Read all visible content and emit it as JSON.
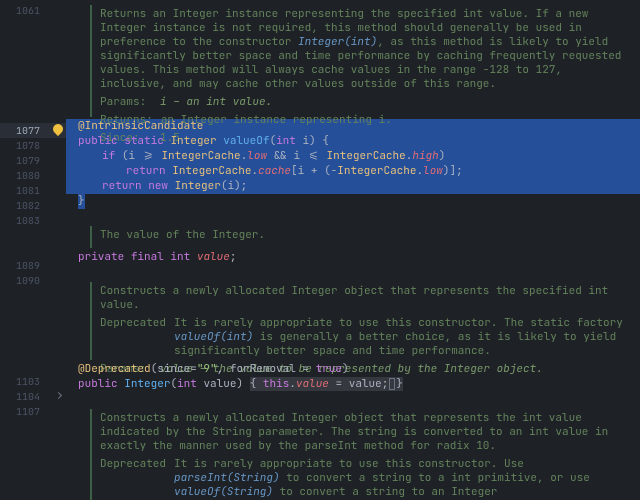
{
  "gutter": {
    "lines": [
      1061,
      "",
      "",
      "",
      "",
      "",
      "",
      "",
      1077,
      1078,
      1079,
      1080,
      1081,
      1082,
      1083,
      "",
      "",
      1089,
      1090,
      "",
      "",
      "",
      "",
      "",
      "",
      1103,
      1104,
      1107,
      "",
      "",
      "",
      "",
      ""
    ]
  },
  "docs": {
    "valueOf": {
      "body": "Returns an Integer instance representing the specified int value. If a new Integer instance is not required, this method should generally be used in preference to the constructor ",
      "ctor": "Integer(int)",
      "body2": ", as this method is likely to yield significantly better space and time performance by caching frequently requested values. This method will always cache values in the range -128 to 127, inclusive, and may cache other values outside of this range.",
      "params_lbl": "Params:",
      "params_val": "i – an int value.",
      "returns_lbl": "Returns:",
      "returns_val": "an Integer instance representing i.",
      "since_lbl": "Since:",
      "since_val": "1.5"
    },
    "value": {
      "body": "The value of the Integer."
    },
    "ctorInt": {
      "body": "Constructs a newly allocated Integer object that represents the specified int value.",
      "dep_lbl": "Deprecated",
      "dep_body_a": "It is rarely appropriate to use this constructor. The static factory ",
      "dep_link": "valueOf(int)",
      "dep_body_b": " is generally a better choice, as it is likely to yield significantly better space and time performance.",
      "params_lbl": "Params:",
      "params_val": "value – the value to be represented by the Integer object."
    },
    "ctorStr": {
      "body": "Constructs a newly allocated Integer object that represents the int value indicated by the String parameter. The string is converted to an int value in exactly the manner used by the parseInt method for radix 10.",
      "dep_lbl": "Deprecated",
      "dep_body_a": "It is rarely appropriate to use this constructor. Use ",
      "dep_link1": "parseInt(String)",
      "dep_body_b": " to convert a string to a int primitive, or use ",
      "dep_link2": "valueOf(String)",
      "dep_body_c": " to convert a string to an Integer"
    }
  },
  "code": {
    "ic_annotation": "@IntrinsicCandidate",
    "kw_public": "public",
    "kw_static": "static",
    "kw_final": "final",
    "kw_private": "private",
    "kw_if": "if",
    "kw_return": "return",
    "kw_new": "new",
    "kw_int": "int",
    "kw_this": "this",
    "kw_true": "true",
    "type_integer": "Integer",
    "type_ic": "IntegerCache",
    "fn_valueOf": "valueOf",
    "fn_Integer": "Integer",
    "field_low": "low",
    "field_high": "high",
    "field_cache": "cache",
    "field_value": "value",
    "param_i": "i",
    "param_value": "value",
    "dep_annotation": "@Deprecated",
    "dep_since_k": "since",
    "dep_since_v": "\"9\"",
    "dep_forRemoval_k": "forRemoval"
  }
}
